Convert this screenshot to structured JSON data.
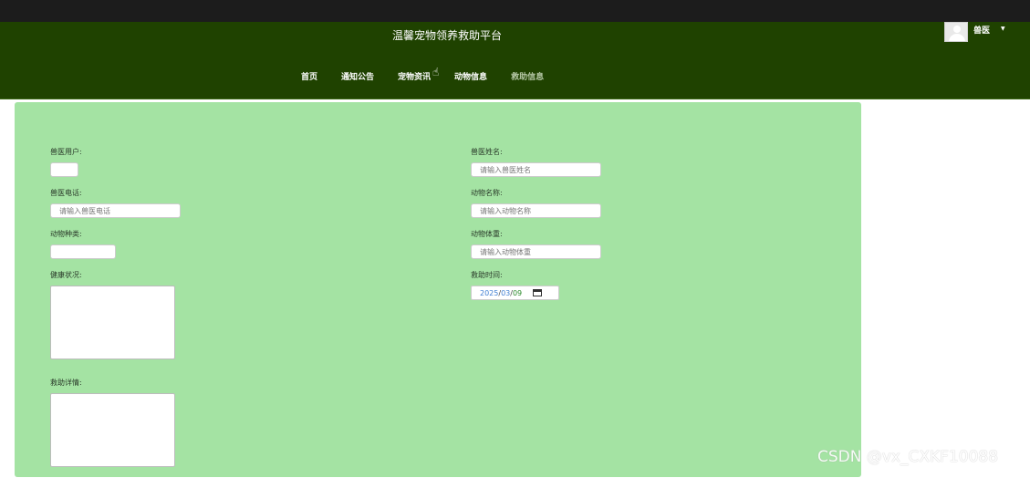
{
  "header": {
    "site_title": "温馨宠物领养救助平台",
    "nav": [
      "首页",
      "通知公告",
      "宠物资讯",
      "动物信息",
      "救助信息"
    ],
    "user_name": "兽医",
    "caret": "▼"
  },
  "form": {
    "vet_user_label": "兽医用户:",
    "vet_user_value": "",
    "vet_name_label": "兽医姓名:",
    "vet_name_placeholder": "请输入兽医姓名",
    "vet_phone_label": "兽医电话:",
    "vet_phone_placeholder": "请输入兽医电话",
    "animal_name_label": "动物名称:",
    "animal_name_placeholder": "请输入动物名称",
    "animal_type_label": "动物种类:",
    "animal_type_value": "",
    "animal_weight_label": "动物体重:",
    "animal_weight_placeholder": "请输入动物体重",
    "health_label": "健康状况:",
    "rescue_time_label": "救助时间:",
    "rescue_time": {
      "year": "2025",
      "month": "03",
      "day": "09",
      "sep": "/"
    },
    "rescue_detail_label": "救助详情:"
  },
  "watermark": "CSDN @vx_CXKF10088"
}
